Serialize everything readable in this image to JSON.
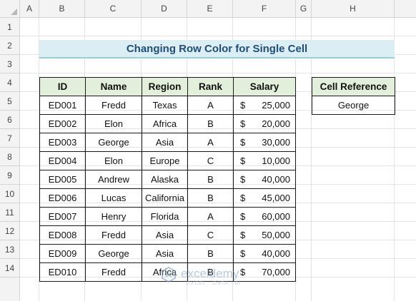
{
  "columns": [
    "A",
    "B",
    "C",
    "D",
    "E",
    "F",
    "G",
    "H"
  ],
  "rows": [
    "1",
    "2",
    "3",
    "4",
    "5",
    "6",
    "7",
    "8",
    "9",
    "10",
    "11",
    "12",
    "13",
    "14"
  ],
  "title": "Changing Row Color for Single Cell",
  "table": {
    "headers": {
      "id": "ID",
      "name": "Name",
      "region": "Region",
      "rank": "Rank",
      "salary": "Salary"
    },
    "currency": "$",
    "records": [
      {
        "id": "ED001",
        "name": "Fredd",
        "region": "Texas",
        "rank": "A",
        "salary": "25,000"
      },
      {
        "id": "ED002",
        "name": "Elon",
        "region": "Africa",
        "rank": "B",
        "salary": "20,000"
      },
      {
        "id": "ED003",
        "name": "George",
        "region": "Asia",
        "rank": "A",
        "salary": "30,000"
      },
      {
        "id": "ED004",
        "name": "Elon",
        "region": "Europe",
        "rank": "C",
        "salary": "10,000"
      },
      {
        "id": "ED005",
        "name": "Andrew",
        "region": "Alaska",
        "rank": "B",
        "salary": "40,000"
      },
      {
        "id": "ED006",
        "name": "Lucas",
        "region": "California",
        "rank": "B",
        "salary": "45,000"
      },
      {
        "id": "ED007",
        "name": "Henry",
        "region": "Florida",
        "rank": "A",
        "salary": "60,000"
      },
      {
        "id": "ED008",
        "name": "Fredd",
        "region": "Asia",
        "rank": "C",
        "salary": "50,000"
      },
      {
        "id": "ED009",
        "name": "George",
        "region": "Asia",
        "rank": "B",
        "salary": "40,000"
      },
      {
        "id": "ED010",
        "name": "Fredd",
        "region": "Africa",
        "rank": "B",
        "salary": "70,000"
      }
    ]
  },
  "cell_reference": {
    "header": "Cell Reference",
    "value": "George"
  },
  "watermark": {
    "name": "exceldemy",
    "tagline": "EXCEL · DATA · BI"
  },
  "colors": {
    "title_fill": "#dbeef4",
    "header_fill": "#e2efda",
    "title_text": "#1f4e79"
  }
}
